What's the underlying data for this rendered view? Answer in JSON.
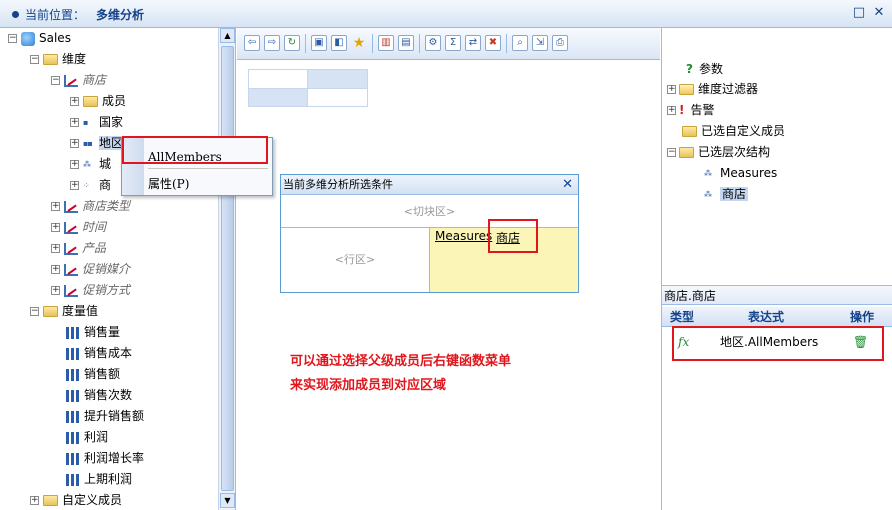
{
  "header": {
    "location_label": "当前位置：",
    "location_value": "多维分析"
  },
  "left_tree": {
    "root": "Sales",
    "dimensions": "维度",
    "store_dim": "商店",
    "members": "成员",
    "country": "国家",
    "region": "地区",
    "city": "城",
    "store": "商",
    "store_type": "商店类型",
    "time": "时间",
    "product": "产品",
    "promo_media": "促销媒介",
    "promo_method": "促销方式",
    "measures": "度量值",
    "measure_items": [
      "销售量",
      "销售成本",
      "销售额",
      "销售次数",
      "提升销售额",
      "利润",
      "利润增长率",
      "上期利润"
    ],
    "custom_members": "自定义成员"
  },
  "context_menu": {
    "all_members": "AllMembers",
    "properties": "属性(P)"
  },
  "condition_panel": {
    "title": "当前多维分析所选条件",
    "slicer": "<切块区>",
    "row_area": "<行区>",
    "col_items": [
      "Measures",
      "商店"
    ]
  },
  "note": {
    "line1": "可以通过选择父级成员后右键函数菜单",
    "line2": "来实现添加成员到对应区域"
  },
  "right_tree": {
    "params": "参数",
    "dim_filter": "维度过滤器",
    "alert": "告警",
    "selected_custom": "已选自定义成员",
    "selected_hier": "已选层次结构",
    "measures": "Measures",
    "store": "商店"
  },
  "expr_panel": {
    "title": "商店.商店",
    "col_type": "类型",
    "col_expr": "表达式",
    "col_op": "操作",
    "row_expr": "地区.AllMembers"
  },
  "colors": {
    "accent": "#15428b",
    "border": "#99bbe8",
    "highlight": "#e0161c",
    "col_area": "#fbf5b8"
  }
}
